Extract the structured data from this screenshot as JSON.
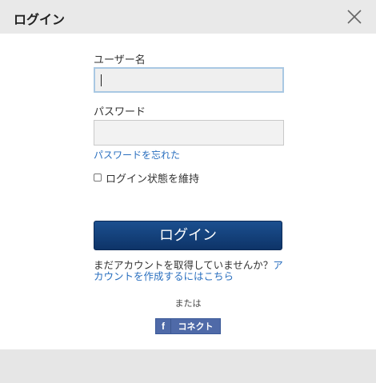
{
  "dialog": {
    "title": "ログイン",
    "close_icon": "close-icon"
  },
  "form": {
    "username_label": "ユーザー名",
    "username_value": "",
    "password_label": "パスワード",
    "password_value": "",
    "forgot_password": "パスワードを忘れた",
    "remember_me": "ログイン状態を維持",
    "remember_checked": false
  },
  "login_button": "ログイン",
  "signup": {
    "prompt": "まだアカウントを取得していませんか？",
    "link": "アカウントを作成するにはこちら"
  },
  "or_text": "または",
  "facebook": {
    "icon": "facebook-icon",
    "label": "コネクト"
  },
  "colors": {
    "link": "#2a6fbf",
    "button": "#0e3468",
    "facebook": "#4f6aa8",
    "header": "#e9e9e9"
  }
}
